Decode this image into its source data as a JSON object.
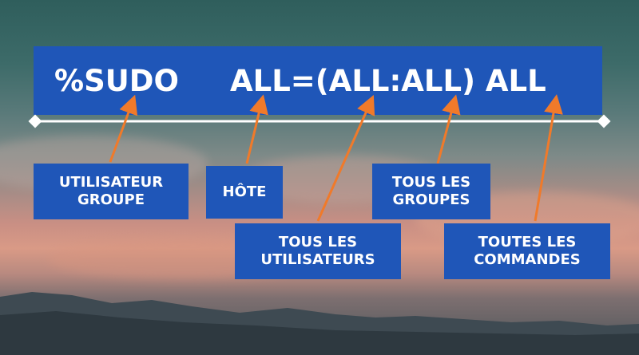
{
  "command": {
    "group": "%SUDO",
    "spec": "ALL=(ALL:ALL) ALL"
  },
  "labels": {
    "group_line1": "UTILISATEUR",
    "group_line2": "GROUPE",
    "host": "HÔTE",
    "users_line1": "TOUS LES",
    "users_line2": "UTILISATEURS",
    "groups_line1": "TOUS LES",
    "groups_line2": "GROUPES",
    "commands_line1": "TOUTES LES",
    "commands_line2": "COMMANDES"
  },
  "colors": {
    "box": "#1f56b8",
    "arrow": "#f07a2a",
    "line": "#ffffff"
  }
}
